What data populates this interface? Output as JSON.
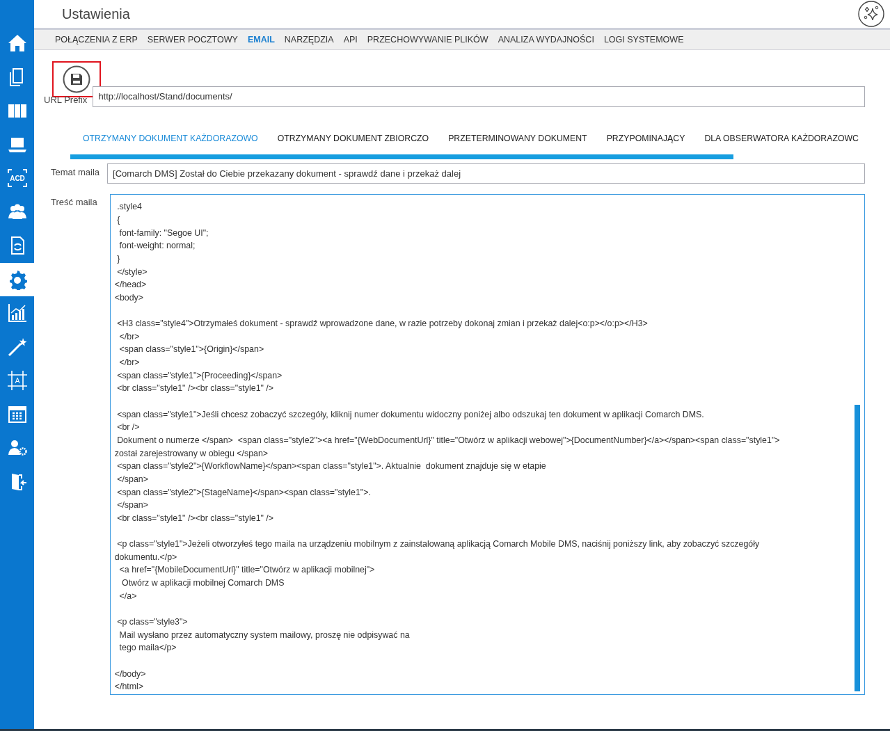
{
  "window": {
    "title": "Ustawienia"
  },
  "sidebar": {
    "items": [
      {
        "kind": "home",
        "selected": false
      },
      {
        "kind": "documents",
        "selected": false
      },
      {
        "kind": "binders",
        "selected": false
      },
      {
        "kind": "laptop",
        "selected": false
      },
      {
        "kind": "acd",
        "selected": false,
        "icon_text": "ACD"
      },
      {
        "kind": "people",
        "selected": false
      },
      {
        "kind": "sync-document",
        "selected": false
      },
      {
        "kind": "gear",
        "selected": true
      },
      {
        "kind": "chart",
        "selected": false
      },
      {
        "kind": "wand",
        "selected": false
      },
      {
        "kind": "frame",
        "selected": false,
        "icon_text": "A"
      },
      {
        "kind": "calendar",
        "selected": false
      },
      {
        "kind": "user-gear",
        "selected": false
      },
      {
        "kind": "exit",
        "selected": false
      }
    ]
  },
  "tabs": [
    {
      "label": "POŁĄCZENIA Z ERP",
      "selected": false
    },
    {
      "label": "SERWER POCZTOWY",
      "selected": false
    },
    {
      "label": "EMAIL",
      "selected": true
    },
    {
      "label": "NARZĘDZIA",
      "selected": false
    },
    {
      "label": "API",
      "selected": false
    },
    {
      "label": "PRZECHOWYWANIE PLIKÓW",
      "selected": false
    },
    {
      "label": "ANALIZA WYDAJNOŚCI",
      "selected": false
    },
    {
      "label": "LOGI SYSTEMOWE",
      "selected": false
    }
  ],
  "save_button": {
    "highlighted": true
  },
  "url_prefix": {
    "label": "URL Prefix",
    "value": "http://localhost/Stand/documents/"
  },
  "template_tabs": [
    {
      "label": "OTRZYMANY DOKUMENT KAŻDORAZOWO",
      "selected": true
    },
    {
      "label": "OTRZYMANY DOKUMENT ZBIORCZO",
      "selected": false
    },
    {
      "label": "PRZETERMINOWANY DOKUMENT",
      "selected": false
    },
    {
      "label": "PRZYPOMINAJĄCY",
      "selected": false
    },
    {
      "label": "DLA OBSERWATORA KAŻDORAZOWC",
      "selected": false
    }
  ],
  "subject": {
    "label": "Temat maila",
    "value": "[Comarch DMS] Został do Ciebie przekazany dokument - sprawdź dane i przekaż dalej"
  },
  "body": {
    "label": "Treść maila",
    "paragraphs": [
      [
        " .style4",
        " {",
        "  font-family: \"Segoe UI\";",
        "  font-weight: normal;",
        " }",
        " </style>",
        "</head>",
        "<body>"
      ],
      [
        " <H3 class=\"style4\">Otrzymałeś dokument - sprawdź wprowadzone dane, w razie potrzeby dokonaj zmian i przekaż dalej<o:p></o:p></H3>",
        "  </br>",
        "  <span class=\"style1\">{Origin}</span>",
        "  </br>",
        " <span class=\"style1\">{Proceeding}</span>",
        " <br class=\"style1\" /><br class=\"style1\" />"
      ],
      [
        " <span class=\"style1\">Jeśli chcesz zobaczyć szczegóły, kliknij numer dokumentu widoczny poniżej albo odszukaj ten dokument w aplikacji Comarch DMS.",
        " <br />",
        " Dokument o numerze </span>  <span class=\"style2\"><a href=\"{WebDocumentUrl}\" title=\"Otwórz w aplikacji webowej\">{DocumentNumber}</a></span><span class=\"style1\">",
        "został zarejestrowany w obiegu </span>",
        " <span class=\"style2\">{WorkflowName}</span><span class=\"style1\">. Aktualnie  dokument znajduje się w etapie",
        " </span>",
        " <span class=\"style2\">{StageName}</span><span class=\"style1\">.",
        " </span>",
        " <br class=\"style1\" /><br class=\"style1\" />"
      ],
      [
        " <p class=\"style1\">Jeżeli otworzyłeś tego maila na urządzeniu mobilnym z zainstalowaną aplikacją Comarch Mobile DMS, naciśnij poniższy link, aby zobaczyć szczegóły",
        "dokumentu.</p>",
        "  <a href=\"{MobileDocumentUrl}\" title=\"Otwórz w aplikacji mobilnej\">",
        "   Otwórz w aplikacji mobilnej Comarch DMS",
        "  </a>"
      ],
      [
        " <p class=\"style3\">",
        "  Mail wysłano przez automatyczny system mailowy, proszę nie odpisywać na",
        "  tego maila</p>"
      ],
      [
        "</body>",
        "</html>"
      ]
    ]
  }
}
